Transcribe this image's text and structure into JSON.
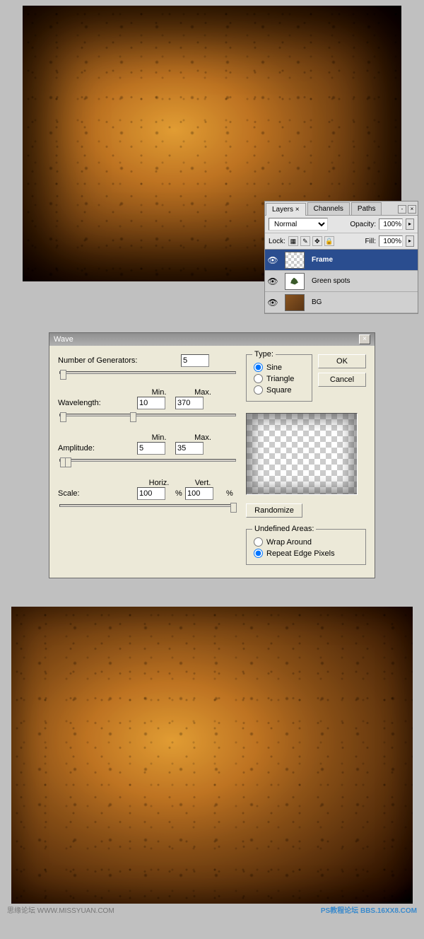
{
  "layers_panel": {
    "tabs": [
      "Layers",
      "Channels",
      "Paths"
    ],
    "active_tab": "Layers",
    "blend_mode": "Normal",
    "opacity_label": "Opacity:",
    "opacity_value": "100%",
    "lock_label": "Lock:",
    "fill_label": "Fill:",
    "fill_value": "100%",
    "layers": [
      {
        "name": "Frame",
        "visible": true,
        "selected": true,
        "thumb": "checker"
      },
      {
        "name": "Green spots",
        "visible": true,
        "selected": false,
        "thumb": "green"
      },
      {
        "name": "BG",
        "visible": true,
        "selected": false,
        "thumb": "bg"
      }
    ]
  },
  "wave": {
    "title": "Wave",
    "generators_label": "Number of Generators:",
    "generators_value": "5",
    "min_label": "Min.",
    "max_label": "Max.",
    "wavelength_label": "Wavelength:",
    "wavelength_min": "10",
    "wavelength_max": "370",
    "amplitude_label": "Amplitude:",
    "amplitude_min": "5",
    "amplitude_max": "35",
    "horiz_label": "Horiz.",
    "vert_label": "Vert.",
    "scale_label": "Scale:",
    "scale_h": "100",
    "scale_v": "100",
    "percent": "%",
    "type_label": "Type:",
    "type_options": {
      "sine": "Sine",
      "triangle": "Triangle",
      "square": "Square"
    },
    "type_selected": "Sine",
    "ok": "OK",
    "cancel": "Cancel",
    "randomize": "Randomize",
    "undefined_label": "Undefined Areas:",
    "wrap": "Wrap Around",
    "repeat": "Repeat Edge Pixels",
    "undefined_selected": "Repeat Edge Pixels"
  },
  "footer": {
    "left": "思缘论坛  WWW.MISSYUAN.COM",
    "right_badge": "PS教程论坛",
    "right_url": "BBS.16XX8.COM"
  }
}
